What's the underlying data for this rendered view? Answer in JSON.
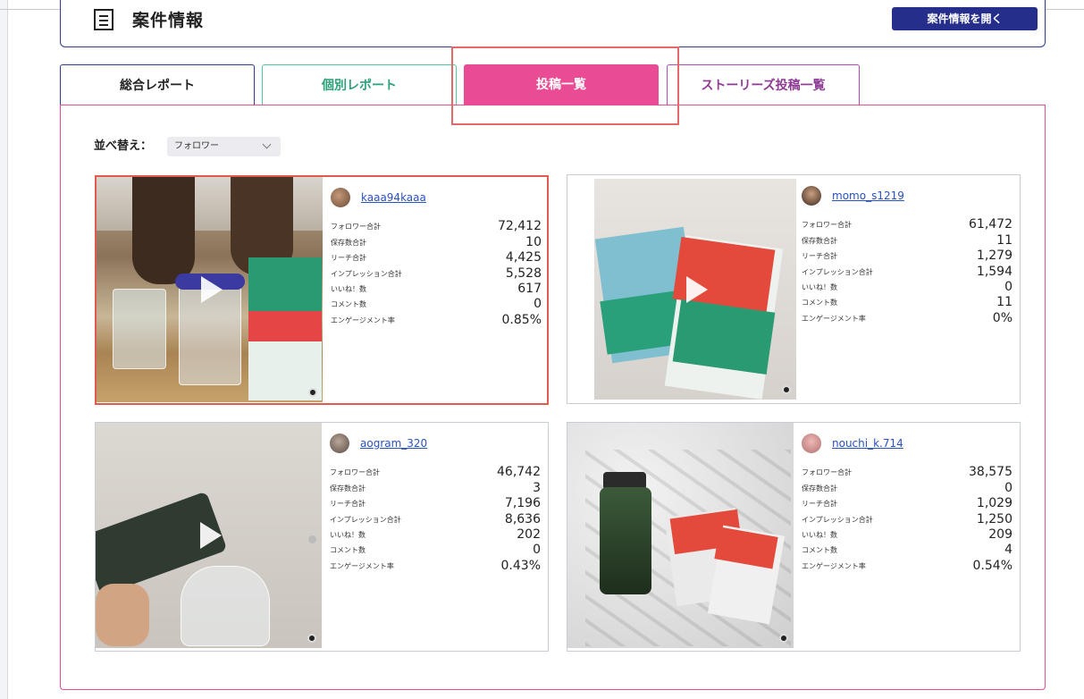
{
  "header": {
    "title": "案件情報",
    "open_button": "案件情報を開く"
  },
  "tabs": {
    "overall": "総合レポート",
    "individual": "個別レポート",
    "posts": "投稿一覧",
    "stories": "ストーリーズ投稿一覧"
  },
  "sort": {
    "label": "並べ替え：",
    "selected": "フォロワー"
  },
  "stat_labels": {
    "followers": "フォロワー合計",
    "saves": "保存数合計",
    "reach": "リーチ合計",
    "impressions": "インプレッション合計",
    "likes": "いいね！数",
    "comments": "コメント数",
    "engagement": "エンゲージメント率"
  },
  "posts": [
    {
      "username": "kaaa94kaaa",
      "followers": "72,412",
      "saves": "10",
      "reach": "4,425",
      "impressions": "5,528",
      "likes": "617",
      "comments": "0",
      "engagement": "0.85%"
    },
    {
      "username": "momo_s1219",
      "followers": "61,472",
      "saves": "11",
      "reach": "1,279",
      "impressions": "1,594",
      "likes": "0",
      "comments": "11",
      "engagement": "0%"
    },
    {
      "username": "aogram_320",
      "followers": "46,742",
      "saves": "3",
      "reach": "7,196",
      "impressions": "8,636",
      "likes": "202",
      "comments": "0",
      "engagement": "0.43%"
    },
    {
      "username": "nouchi_k.714",
      "followers": "38,575",
      "saves": "0",
      "reach": "1,029",
      "impressions": "1,250",
      "likes": "209",
      "comments": "4",
      "engagement": "0.54%"
    }
  ],
  "colors": {
    "primary_navy": "#262e8c",
    "active_tab_pink": "#ea4b95",
    "individual_tab_green": "#4ecb9f",
    "stories_tab_purple": "#b24ab8",
    "highlight_red": "#e05a4e",
    "link_blue": "#2a52be"
  },
  "icons": {
    "header": "list-icon",
    "sort": "chevron-down-icon",
    "video": "play-icon",
    "media": "camera-icon"
  }
}
